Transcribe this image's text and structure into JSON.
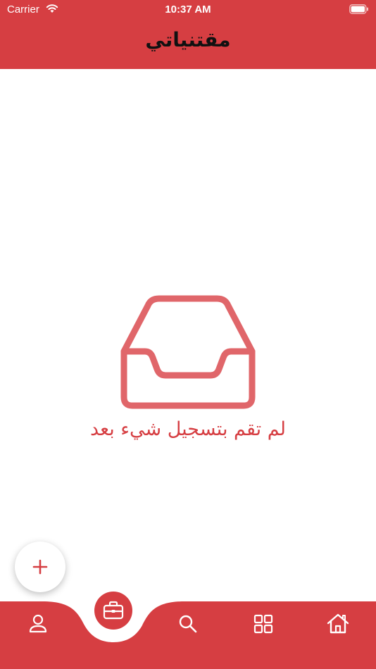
{
  "status_bar": {
    "carrier": "Carrier",
    "time": "10:37 AM",
    "wifi_icon": "wifi-icon",
    "battery_icon": "battery-icon"
  },
  "header": {
    "title": "مقتنياتي",
    "background_color": "#d63e42"
  },
  "empty_state": {
    "icon": "inbox-tray-icon",
    "message": "لم تقم بتسجيل شيء بعد",
    "accent_color": "#d63e42"
  },
  "fab": {
    "icon": "plus-icon"
  },
  "bottom_nav": {
    "background_color": "#d63e42",
    "items": [
      {
        "name": "profile",
        "icon": "person-icon",
        "active": false
      },
      {
        "name": "collections",
        "icon": "briefcase-icon",
        "active": true
      },
      {
        "name": "search",
        "icon": "search-icon",
        "active": false
      },
      {
        "name": "categories",
        "icon": "grid-icon",
        "active": false
      },
      {
        "name": "home",
        "icon": "home-icon",
        "active": false
      }
    ]
  }
}
